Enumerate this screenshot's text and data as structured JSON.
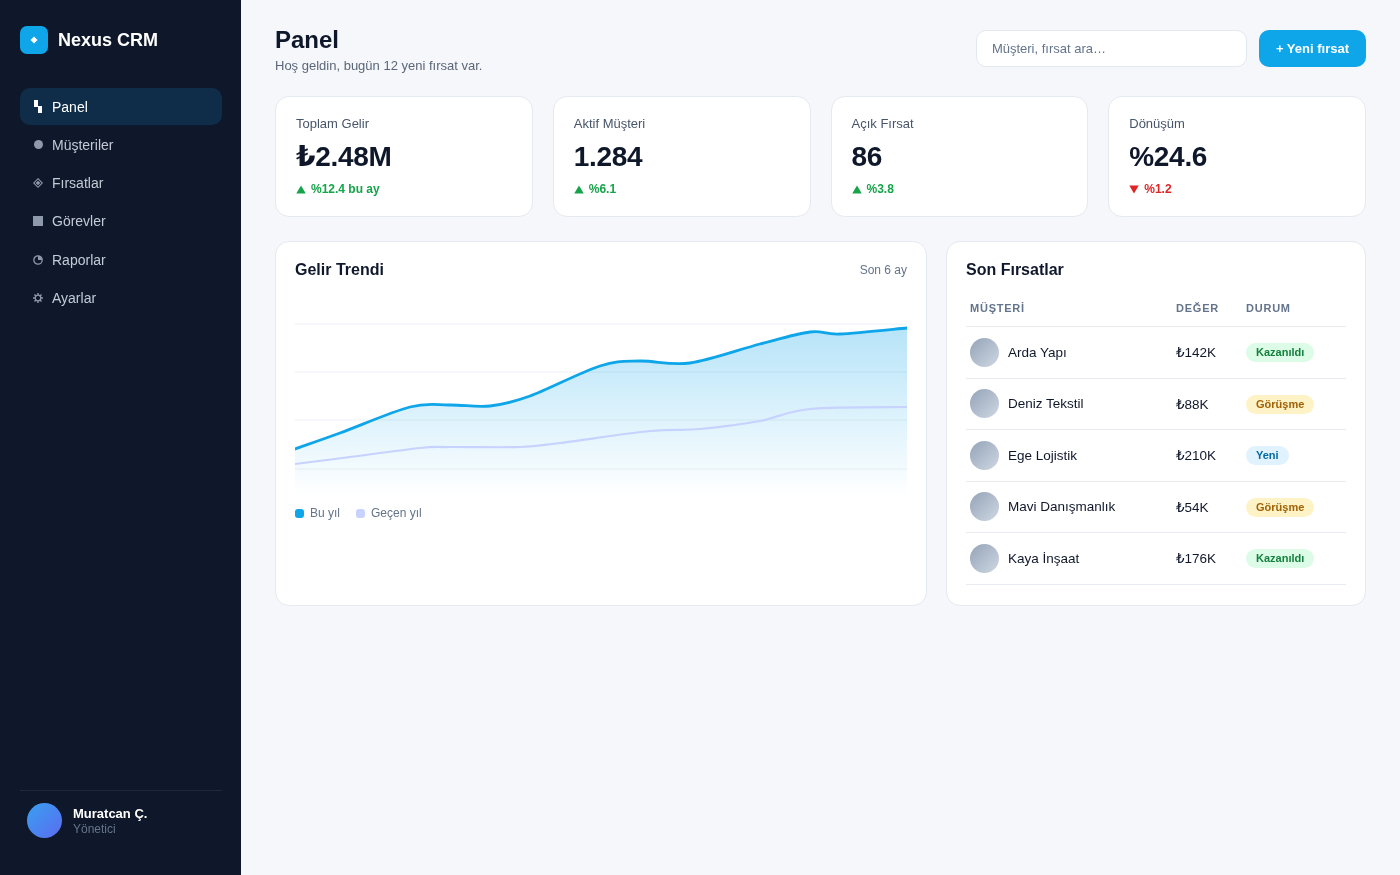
{
  "sidebar": {
    "brand": "Nexus CRM",
    "items": [
      {
        "label": "Panel",
        "selected": true
      },
      {
        "label": "Müşteriler",
        "selected": false
      },
      {
        "label": "Fırsatlar",
        "selected": false
      },
      {
        "label": "Görevler",
        "selected": false
      },
      {
        "label": "Raporlar",
        "selected": false
      },
      {
        "label": "Ayarlar",
        "selected": false
      }
    ],
    "user": {
      "name": "Muratcan Ç.",
      "role": "Yönetici"
    }
  },
  "header": {
    "title": "Panel",
    "subtitle": "Hoş geldin, bugün 12 yeni fırsat var.",
    "search": {
      "placeholder": "Müşteri, fırsat ara…"
    },
    "new_button": "+ Yeni fırsat"
  },
  "stats": [
    {
      "label": "Toplam Gelir",
      "value": "₺2.48M",
      "change": "%12.4 bu ay",
      "rising": true
    },
    {
      "label": "Aktif Müşteri",
      "value": "1.284",
      "change": "%6.1",
      "rising": true
    },
    {
      "label": "Açık Fırsat",
      "value": "86",
      "change": "%3.8",
      "rising": true
    },
    {
      "label": "Dönüşüm",
      "value": "%24.6",
      "change": "%1.2",
      "rising": false
    }
  ],
  "revenue_chart": {
    "title": "Gelir Trendi",
    "period": "Son 6 ay",
    "legend": [
      {
        "label": "Bu yıl",
        "color": "#0ea5e9"
      },
      {
        "label": "Geçen yıl",
        "color": "#c7d2fe"
      }
    ]
  },
  "deals": {
    "title": "Son Fırsatlar",
    "columns": [
      "MÜŞTERİ",
      "DEĞER",
      "DURUM"
    ],
    "rows": [
      {
        "customer": "Arda Yapı",
        "value": "₺142K",
        "status": {
          "label": "Kazanıldı",
          "kind": "won"
        }
      },
      {
        "customer": "Deniz Tekstil",
        "value": "₺88K",
        "status": {
          "label": "Görüşme",
          "kind": "meeting"
        }
      },
      {
        "customer": "Ege Lojistik",
        "value": "₺210K",
        "status": {
          "label": "Yeni",
          "kind": "new"
        }
      },
      {
        "customer": "Mavi Danışmanlık",
        "value": "₺54K",
        "status": {
          "label": "Görüşme",
          "kind": "meeting"
        }
      },
      {
        "customer": "Kaya İnşaat",
        "value": "₺176K",
        "status": {
          "label": "Kazanıldı",
          "kind": "won"
        }
      }
    ]
  }
}
